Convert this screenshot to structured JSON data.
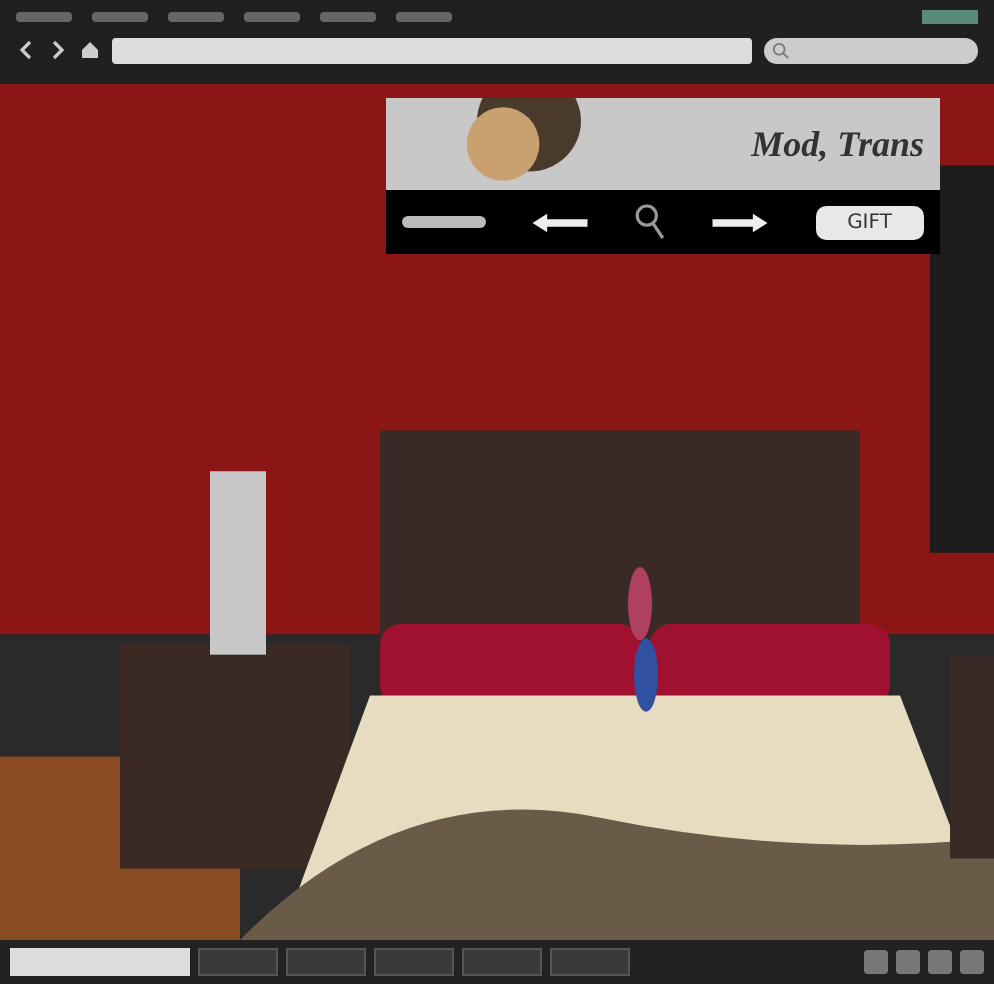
{
  "hud": {
    "caption": "Mod, Trans",
    "gift_button": "GIFT"
  }
}
